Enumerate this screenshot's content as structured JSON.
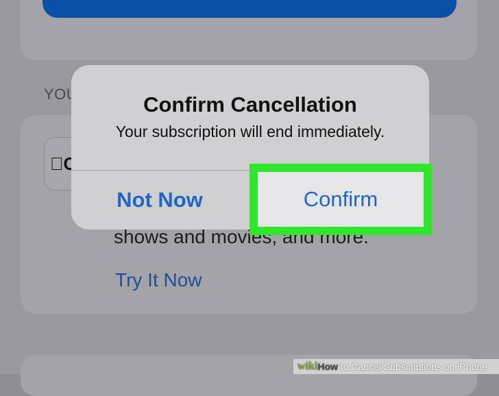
{
  "background": {
    "section_header": "YOU",
    "app_icon_text": "C",
    "description": "shows and movies, and more.",
    "try_link": "Try It Now"
  },
  "alert": {
    "title": "Confirm Cancellation",
    "message": "Your subscription will end immediately.",
    "not_now_label": "Not Now",
    "confirm_label": "Confirm"
  },
  "watermark": {
    "brand_prefix": "wiki",
    "brand_how": "How",
    "caption": "to Cancel Subscriptions on iPhone"
  },
  "colors": {
    "highlight": "#2ee62a",
    "link_blue": "#1f66c9",
    "primary_button": "#0a4fa8"
  }
}
